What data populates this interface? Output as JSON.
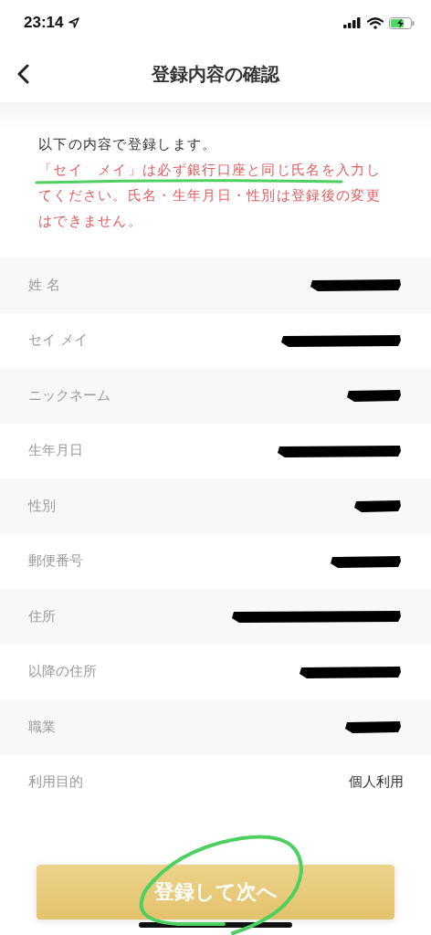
{
  "status_bar": {
    "time": "23:14"
  },
  "nav": {
    "title": "登録内容の確認"
  },
  "notice": {
    "intro": "以下の内容で登録します。",
    "warning": "「セイ　メイ」は必ず銀行口座と同じ氏名を入力してください。氏名・生年月日・性別は登録後の変更はできません。",
    "underlined": true
  },
  "rows": [
    {
      "label": "姓 名",
      "redacted": true
    },
    {
      "label": "セイ メイ",
      "redacted": true
    },
    {
      "label": "ニックネーム",
      "redacted": true
    },
    {
      "label": "生年月日",
      "redacted": true
    },
    {
      "label": "性別",
      "redacted": true
    },
    {
      "label": "郵便番号",
      "redacted": true
    },
    {
      "label": "住所",
      "redacted": true
    },
    {
      "label": "以降の住所",
      "redacted": true
    },
    {
      "label": "職業",
      "redacted": true
    },
    {
      "label": "利用目的",
      "redacted": false,
      "value": "個人利用"
    }
  ],
  "submit_button": {
    "label": "登録して次へ",
    "circled": true
  }
}
